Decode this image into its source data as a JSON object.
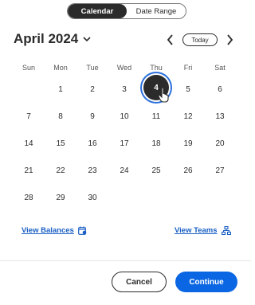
{
  "view_toggle": {
    "calendar_label": "Calendar",
    "date_range_label": "Date Range",
    "selected": "Calendar"
  },
  "header": {
    "month_title": "April 2024",
    "today_label": "Today"
  },
  "weekdays": [
    "Sun",
    "Mon",
    "Tue",
    "Wed",
    "Thu",
    "Fri",
    "Sat"
  ],
  "days": [
    "",
    "1",
    "2",
    "3",
    "4",
    "5",
    "6",
    "7",
    "8",
    "9",
    "10",
    "11",
    "12",
    "13",
    "14",
    "15",
    "16",
    "17",
    "18",
    "19",
    "20",
    "21",
    "22",
    "23",
    "24",
    "25",
    "26",
    "27",
    "28",
    "29",
    "30",
    "",
    "",
    "",
    ""
  ],
  "selected_day": "4",
  "links": {
    "view_balances": "View Balances",
    "view_teams": "View Teams"
  },
  "footer": {
    "cancel_label": "Cancel",
    "continue_label": "Continue"
  },
  "colors": {
    "accent": "#0a66e3",
    "link": "#1a5fc4",
    "selected_day_bg": "#2b2b2b",
    "focus_ring": "#2a6fdb"
  },
  "icons": {
    "month_dropdown": "chevron-down-icon",
    "prev": "chevron-left-icon",
    "next": "chevron-right-icon",
    "balances": "calendar-balance-icon",
    "teams": "org-chart-icon",
    "cursor": "hand-pointer-icon"
  }
}
